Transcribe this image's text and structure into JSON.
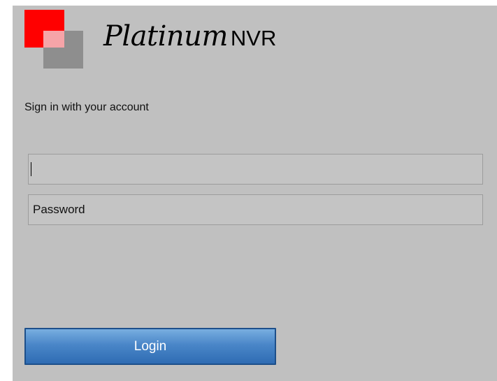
{
  "brand": {
    "script_name": "Platinum",
    "suffix": "NVR"
  },
  "signin": {
    "subtitle": "Sign in with your account",
    "username": {
      "value": "",
      "placeholder": ""
    },
    "password": {
      "value": "",
      "placeholder": "Password"
    },
    "login_label": "Login"
  },
  "colors": {
    "panel_background": "#c0c0c0",
    "logo_red": "#ff0000",
    "logo_pink": "#f6a4a8",
    "logo_gray": "#8e8e8e",
    "button_blue": "#4a86c8"
  },
  "icons": {
    "logo": "red-gray-squares-logo"
  }
}
